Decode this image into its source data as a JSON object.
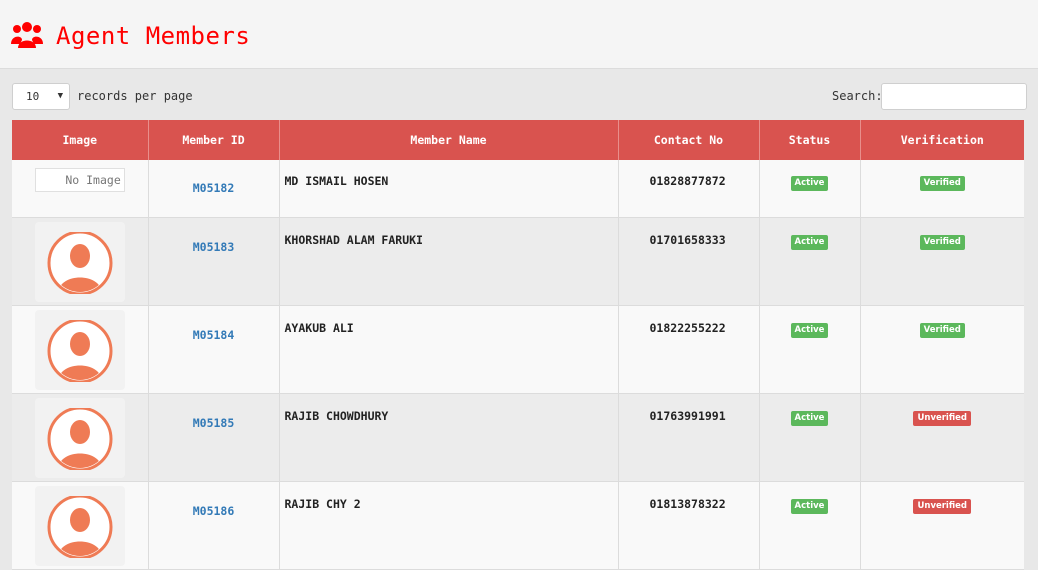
{
  "header": {
    "title": "Agent Members",
    "icon": "users-icon",
    "accent": "#ff0000"
  },
  "controls": {
    "page_size": "10",
    "page_size_suffix": "records per page",
    "search_label": "Search:",
    "search_value": ""
  },
  "table": {
    "columns": [
      "Image",
      "Member ID",
      "Member Name",
      "Contact No",
      "Status",
      "Verification"
    ],
    "rows": [
      {
        "image": "No Image",
        "id": "M05182",
        "name": "MD ISMAIL HOSEN",
        "contact": "01828877872",
        "status": "Active",
        "verification": "Verified"
      },
      {
        "image": "avatar",
        "id": "M05183",
        "name": "KHORSHAD ALAM FARUKI",
        "contact": "01701658333",
        "status": "Active",
        "verification": "Verified"
      },
      {
        "image": "avatar",
        "id": "M05184",
        "name": "AYAKUB ALI",
        "contact": "01822255222",
        "status": "Active",
        "verification": "Verified"
      },
      {
        "image": "avatar",
        "id": "M05185",
        "name": "RAJIB CHOWDHURY",
        "contact": "01763991991",
        "status": "Active",
        "verification": "Unverified"
      },
      {
        "image": "avatar",
        "id": "M05186",
        "name": "RAJIB CHY 2",
        "contact": "01813878322",
        "status": "Active",
        "verification": "Unverified"
      }
    ]
  },
  "colors": {
    "header_row": "#d9534f",
    "link": "#337ab7",
    "active": "#5cb85c",
    "unverified": "#d9534f"
  }
}
